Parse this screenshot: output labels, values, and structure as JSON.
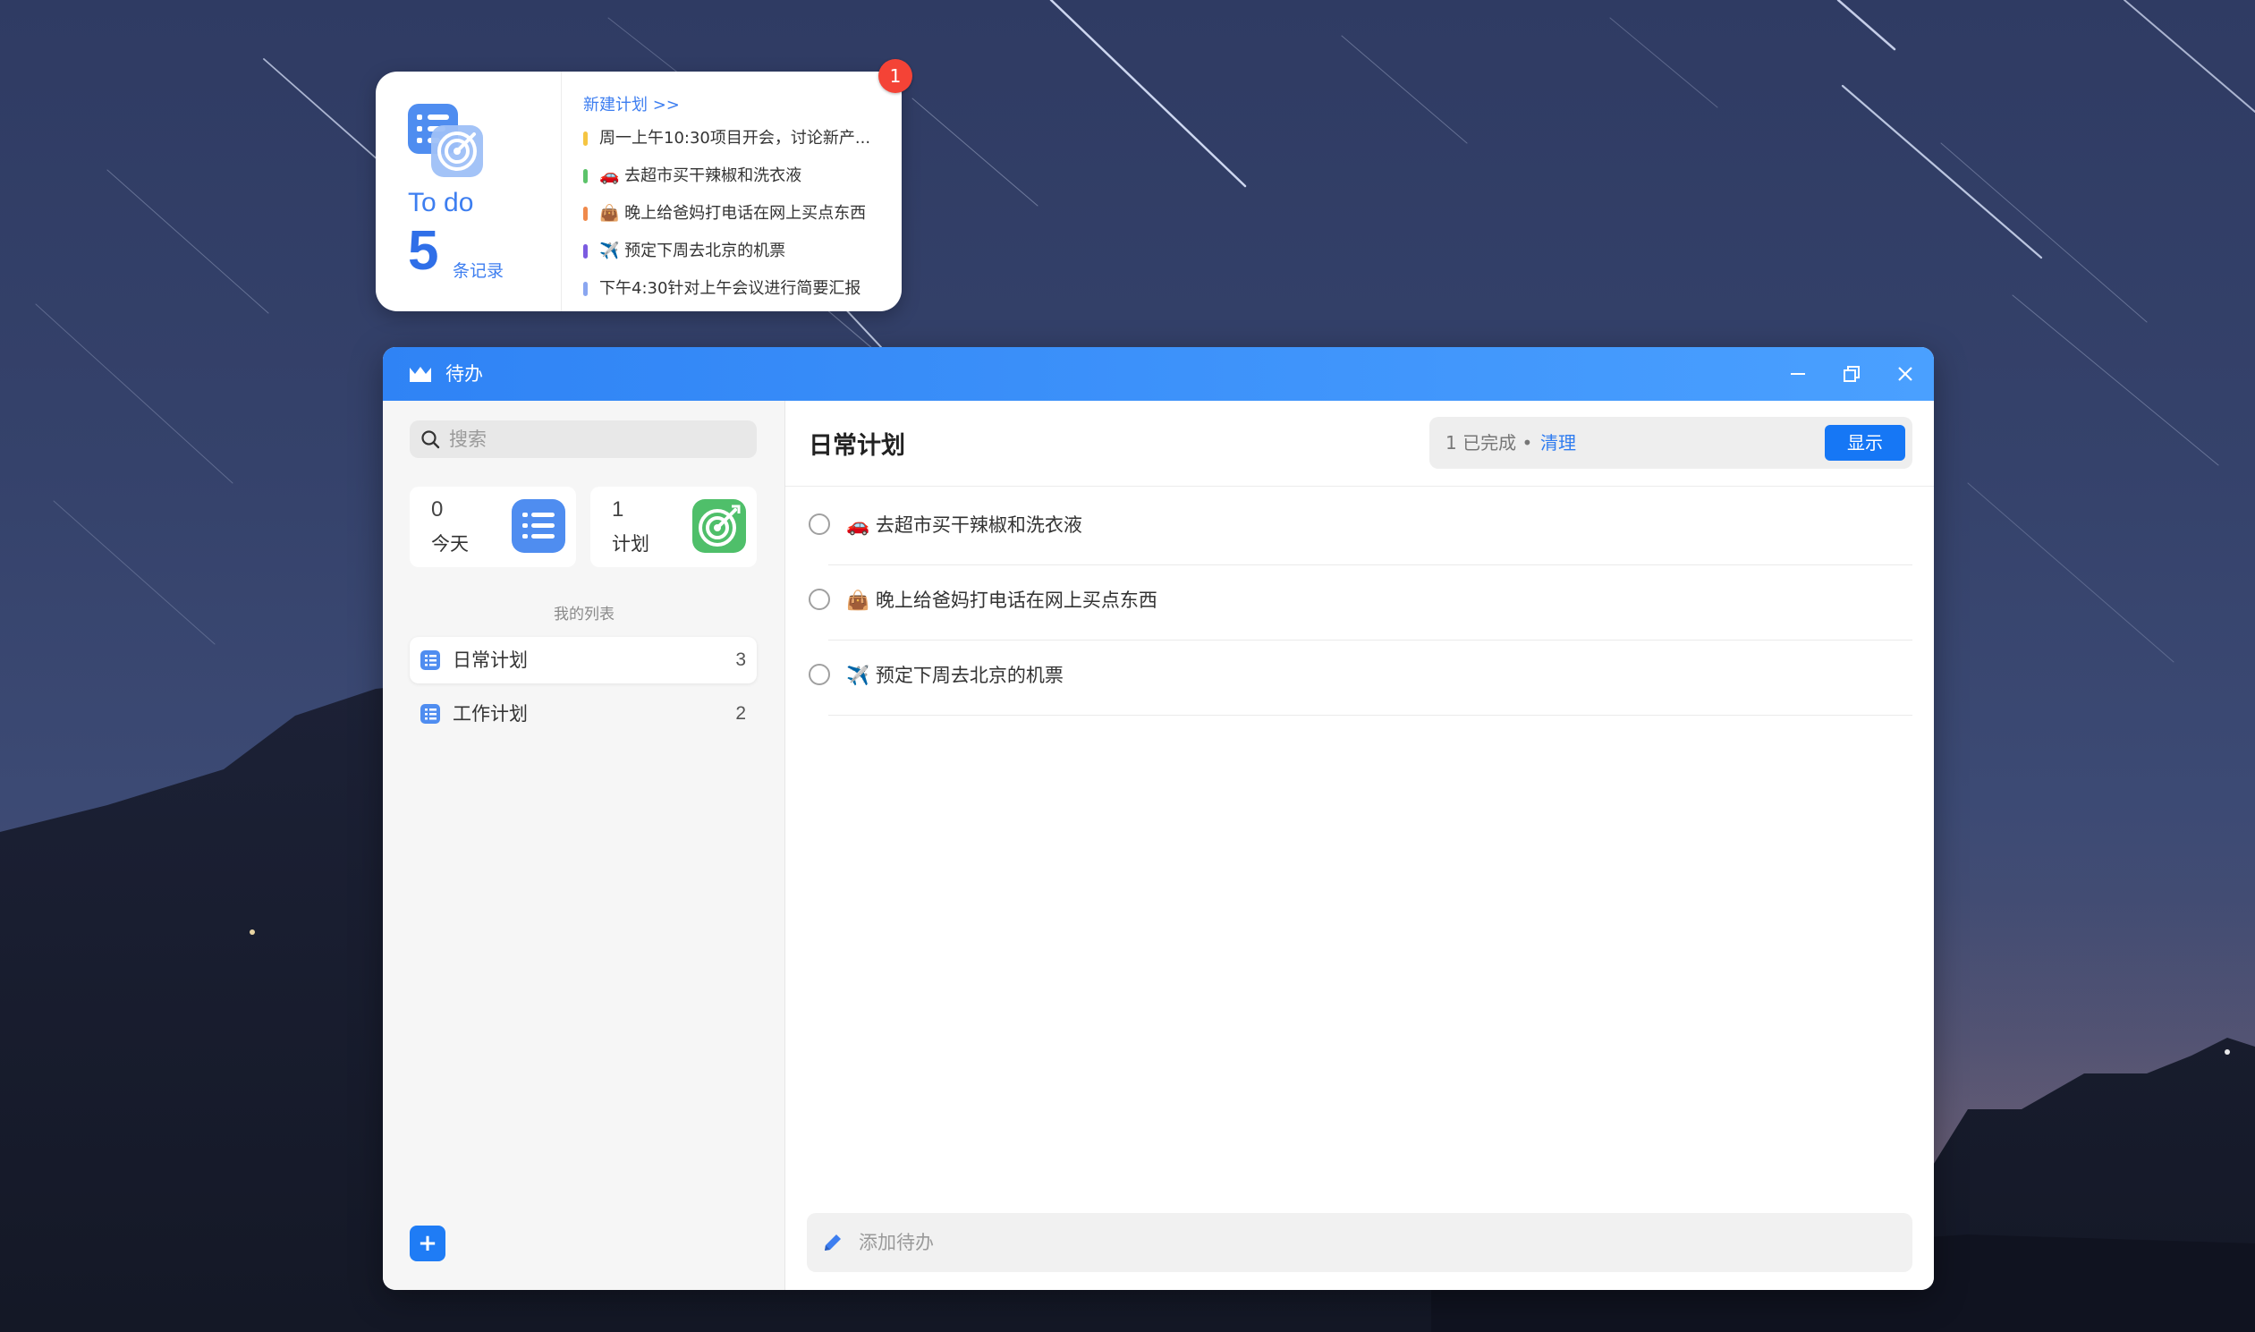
{
  "widget": {
    "title": "To do",
    "count": "5",
    "count_label": "条记录",
    "new_plan": "新建计划 >>",
    "badge": "1",
    "items": [
      {
        "text": "周一上午10:30项目开会，讨论新产...",
        "color": "#f5c542"
      },
      {
        "text": "🚗 去超市买干辣椒和洗衣液",
        "color": "#5cc36a"
      },
      {
        "text": "👜 晚上给爸妈打电话在网上买点东西",
        "color": "#f08a4b"
      },
      {
        "text": "✈️ 预定下周去北京的机票",
        "color": "#7b5be0"
      },
      {
        "text": "下午4:30针对上午会议进行简要汇报",
        "color": "#8aa6f0"
      }
    ]
  },
  "window": {
    "title": "待办",
    "accent": "#2f83f5"
  },
  "sidebar": {
    "search_placeholder": "搜索",
    "stats": [
      {
        "count": "0",
        "label": "今天",
        "icon": "list-icon"
      },
      {
        "count": "1",
        "label": "计划",
        "icon": "target-icon"
      }
    ],
    "section_label": "我的列表",
    "lists": [
      {
        "label": "日常计划",
        "count": "3",
        "active": true
      },
      {
        "label": "工作计划",
        "count": "2",
        "active": false
      }
    ],
    "add_button": "+"
  },
  "main": {
    "title": "日常计划",
    "done_count": "1 已完成 •",
    "clean_label": "清理",
    "show_label": "显示",
    "tasks": [
      {
        "text": "🚗 去超市买干辣椒和洗衣液"
      },
      {
        "text": "👜 晚上给爸妈打电话在网上买点东西"
      },
      {
        "text": "✈️ 预定下周去北京的机票"
      }
    ],
    "add_placeholder": "添加待办"
  }
}
